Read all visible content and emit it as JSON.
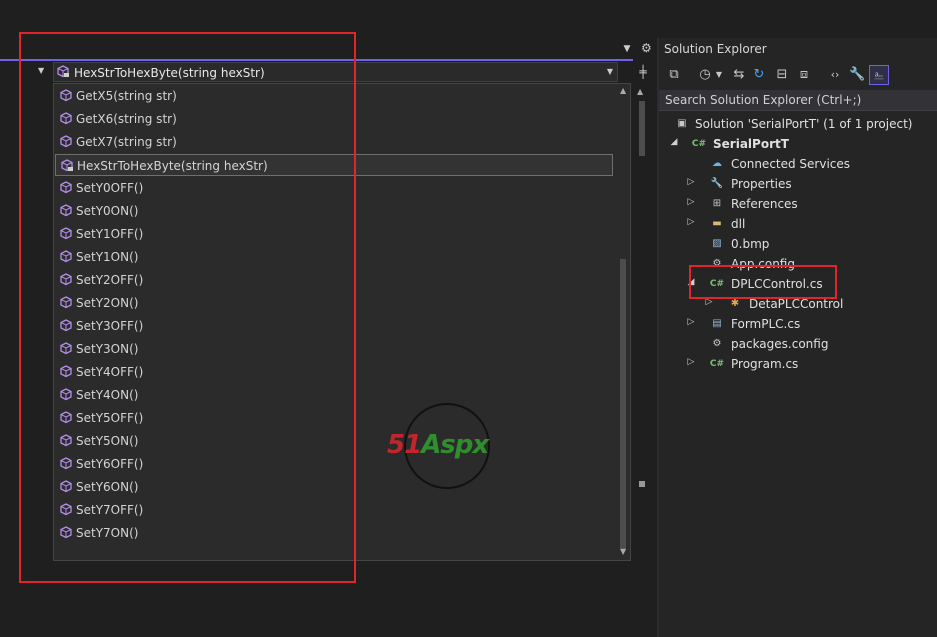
{
  "navbar": {
    "member_combo_text": "HexStrToHexByte(string hexStr)"
  },
  "member_list": [
    {
      "label": "GetX5(string str)",
      "selected": false
    },
    {
      "label": "GetX6(string str)",
      "selected": false
    },
    {
      "label": "GetX7(string str)",
      "selected": false
    },
    {
      "label": "HexStrToHexByte(string hexStr)",
      "selected": true
    },
    {
      "label": "SetY0OFF()",
      "selected": false
    },
    {
      "label": "SetY0ON()",
      "selected": false
    },
    {
      "label": "SetY1OFF()",
      "selected": false
    },
    {
      "label": "SetY1ON()",
      "selected": false
    },
    {
      "label": "SetY2OFF()",
      "selected": false
    },
    {
      "label": "SetY2ON()",
      "selected": false
    },
    {
      "label": "SetY3OFF()",
      "selected": false
    },
    {
      "label": "SetY3ON()",
      "selected": false
    },
    {
      "label": "SetY4OFF()",
      "selected": false
    },
    {
      "label": "SetY4ON()",
      "selected": false
    },
    {
      "label": "SetY5OFF()",
      "selected": false
    },
    {
      "label": "SetY5ON()",
      "selected": false
    },
    {
      "label": "SetY6OFF()",
      "selected": false
    },
    {
      "label": "SetY6ON()",
      "selected": false
    },
    {
      "label": "SetY7OFF()",
      "selected": false
    },
    {
      "label": "SetY7ON()",
      "selected": false
    }
  ],
  "solution_explorer": {
    "title": "Solution Explorer",
    "search_placeholder": "Search Solution Explorer (Ctrl+;)",
    "tree": [
      {
        "label": "Solution 'SerialPortT' (1 of 1 project)",
        "icon": "solution-icon",
        "twisty": "none",
        "bold": false
      },
      {
        "label": "SerialPortT",
        "icon": "csharp-project-icon",
        "twisty": "expanded",
        "bold": true
      },
      {
        "label": "Connected Services",
        "icon": "connected-services-icon",
        "twisty": "none",
        "bold": false
      },
      {
        "label": "Properties",
        "icon": "wrench-icon",
        "twisty": "collapsed",
        "bold": false
      },
      {
        "label": "References",
        "icon": "references-icon",
        "twisty": "collapsed",
        "bold": false
      },
      {
        "label": "dll",
        "icon": "folder-icon",
        "twisty": "collapsed",
        "bold": false
      },
      {
        "label": "0.bmp",
        "icon": "image-file-icon",
        "twisty": "none",
        "bold": false
      },
      {
        "label": "App.config",
        "icon": "config-file-icon",
        "twisty": "none",
        "bold": false
      },
      {
        "label": "DPLCControl.cs",
        "icon": "csharp-file-icon",
        "twisty": "expanded",
        "bold": false
      },
      {
        "label": "DetaPLCControl",
        "icon": "class-icon",
        "twisty": "collapsed",
        "bold": false
      },
      {
        "label": "FormPLC.cs",
        "icon": "form-icon",
        "twisty": "collapsed",
        "bold": false
      },
      {
        "label": "packages.config",
        "icon": "config-file-icon",
        "twisty": "none",
        "bold": false
      },
      {
        "label": "Program.cs",
        "icon": "csharp-file-icon",
        "twisty": "collapsed",
        "bold": false
      }
    ]
  },
  "watermark": {
    "brand_a": "51",
    "brand_b": "Aspx"
  },
  "colors": {
    "accent": "#7160e8",
    "highlight_box": "#e0262b",
    "csharp": "#6ec76e",
    "method_icon": "#b48ee8"
  }
}
